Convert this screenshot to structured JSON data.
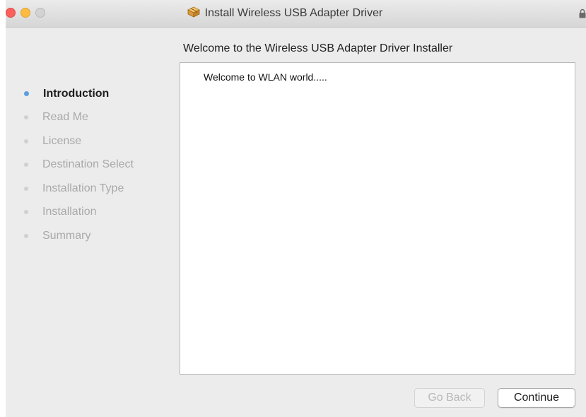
{
  "window": {
    "title": "Install Wireless USB Adapter Driver",
    "title_icon": "package-icon"
  },
  "heading": "Welcome to the Wireless USB Adapter Driver Installer",
  "steps": [
    {
      "label": "Introduction",
      "active": true
    },
    {
      "label": "Read Me",
      "active": false
    },
    {
      "label": "License",
      "active": false
    },
    {
      "label": "Destination Select",
      "active": false
    },
    {
      "label": "Installation Type",
      "active": false
    },
    {
      "label": "Installation",
      "active": false
    },
    {
      "label": "Summary",
      "active": false
    }
  ],
  "content": {
    "text": "Welcome to WLAN world....."
  },
  "buttons": {
    "back_label": "Go Back",
    "back_enabled": false,
    "continue_label": "Continue"
  },
  "colors": {
    "active_step_dot": "#5b9ee0",
    "inactive_step_dot": "#d0d0d0",
    "close_button": "#fc605c",
    "minimize_button": "#fdbc40"
  }
}
